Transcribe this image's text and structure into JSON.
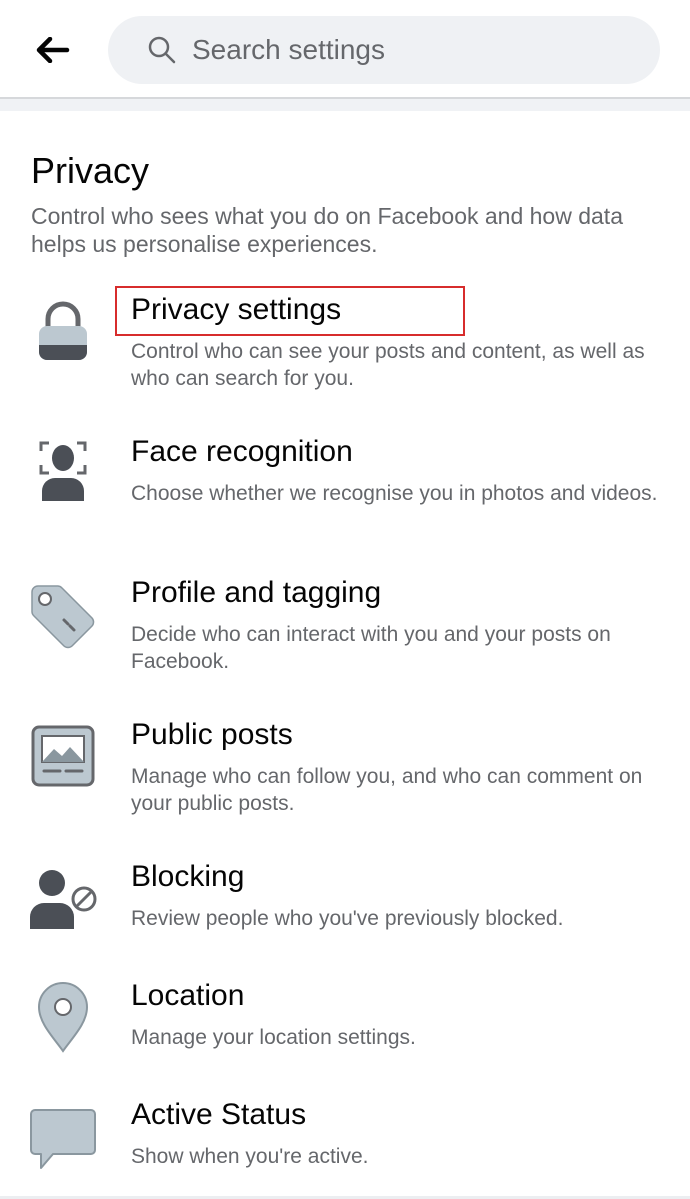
{
  "header": {
    "back_icon": "arrow-left-icon",
    "search": {
      "placeholder": "Search settings",
      "icon": "search-icon"
    }
  },
  "section": {
    "title": "Privacy",
    "description": "Control who sees what you do on Facebook and how data helps us personalise experiences."
  },
  "items": [
    {
      "icon": "lock-icon",
      "title": "Privacy settings",
      "subtitle": "Control who can see your posts and content, as well as who can search for you."
    },
    {
      "icon": "face-recognition-icon",
      "title": "Face recognition",
      "subtitle": "Choose whether we recognise you in photos and videos."
    },
    {
      "icon": "tag-icon",
      "title": "Profile and tagging",
      "subtitle": "Decide who can interact with you and your posts on Facebook."
    },
    {
      "icon": "public-post-icon",
      "title": "Public posts",
      "subtitle": "Manage who can follow you, and who can comment on your public posts."
    },
    {
      "icon": "blocked-user-icon",
      "title": "Blocking",
      "subtitle": "Review people who you've previously blocked."
    },
    {
      "icon": "location-pin-icon",
      "title": "Location",
      "subtitle": "Manage your location settings."
    },
    {
      "icon": "chat-bubble-icon",
      "title": "Active Status",
      "subtitle": "Show when you're active."
    }
  ],
  "highlight_color": "#d72c2c",
  "icon_colors": {
    "fill": "#bcc8d0",
    "dark": "#65676b"
  }
}
